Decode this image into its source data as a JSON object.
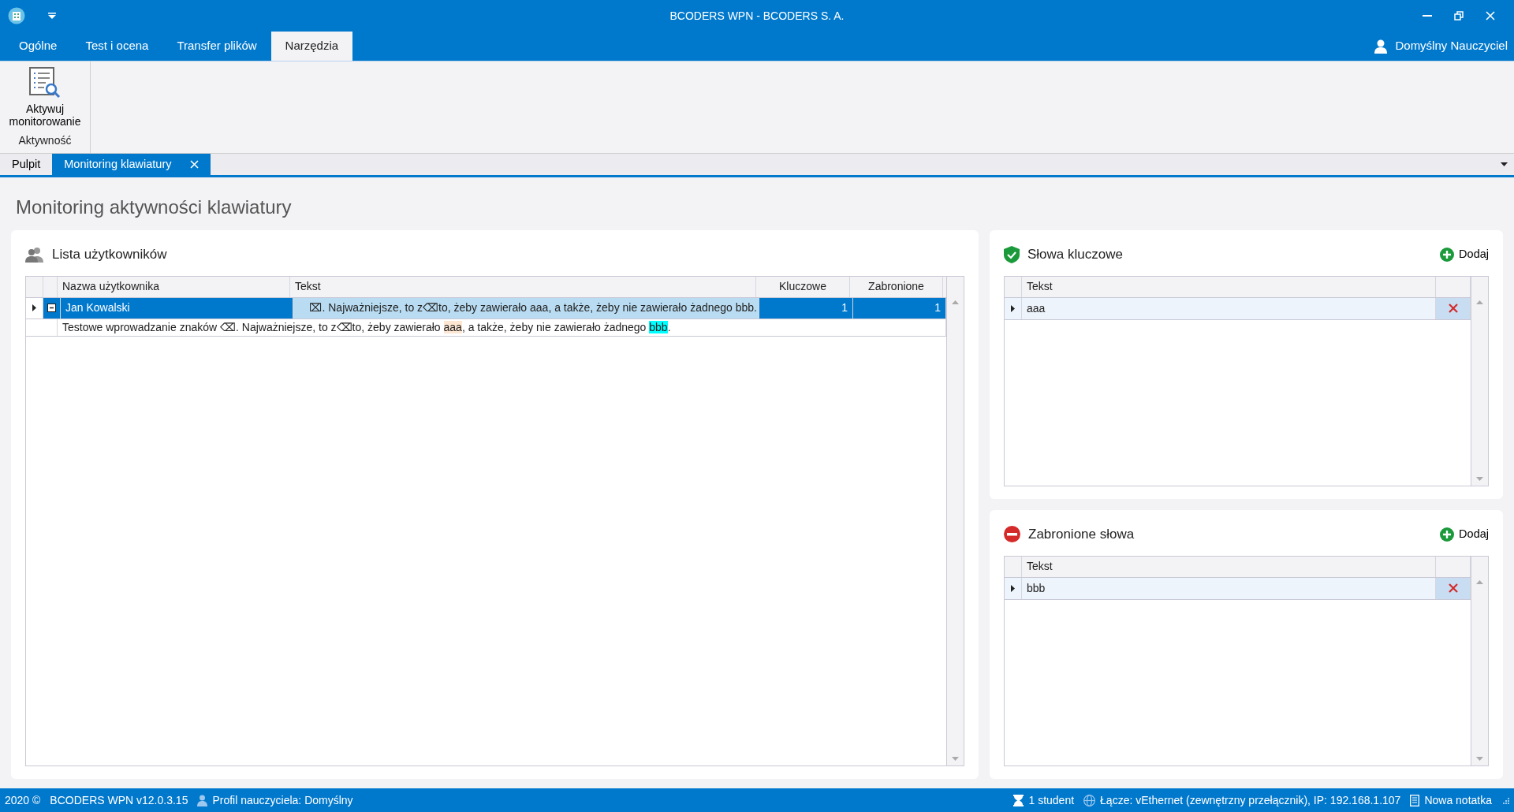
{
  "window": {
    "title": "BCODERS WPN - BCODERS S. A.",
    "user": "Domyślny Nauczyciel"
  },
  "ribbon_tabs": [
    {
      "label": "Ogólne",
      "selected": false
    },
    {
      "label": "Test i ocena",
      "selected": false
    },
    {
      "label": "Transfer plików",
      "selected": false
    },
    {
      "label": "Narzędzia",
      "selected": true
    }
  ],
  "ribbon_group": {
    "button": "Aktywuj monitorowanie",
    "caption": "Aktywność"
  },
  "doc_tabs": [
    {
      "label": "Pulpit",
      "selected": false,
      "closable": false
    },
    {
      "label": "Monitoring klawiatury",
      "selected": true,
      "closable": true
    }
  ],
  "page_title": "Monitoring aktywności klawiatury",
  "users_panel": {
    "title": "Lista użytkowników",
    "columns": [
      "Nazwa użytkownika",
      "Tekst",
      "Kluczowe",
      "Zabronione"
    ],
    "rows": [
      {
        "name": "Jan Kowalski",
        "text": "⌧. Najważniejsze, to z⌫to, żeby zawierało aaa, a także, żeby nie zawierało żadnego bbb.",
        "keywords": "1",
        "forbidden": "1",
        "selected": true,
        "expanded": true,
        "detail": [
          {
            "text": "Testowe wprowadzanie znaków ⌫. Najważniejsze, to z⌫to, żeby zawierało ",
            "kind": "plain"
          },
          {
            "text": "aaa",
            "kind": "keyword"
          },
          {
            "text": ", a także, żeby nie zawierało żadnego ",
            "kind": "plain"
          },
          {
            "text": "bbb",
            "kind": "forbidden"
          },
          {
            "text": ".",
            "kind": "plain"
          }
        ]
      }
    ]
  },
  "word_panels": [
    {
      "kind": "keyword",
      "title": "Słowa kluczowe",
      "add": "Dodaj",
      "column": "Tekst",
      "rows": [
        {
          "text": "aaa",
          "selected": true
        }
      ]
    },
    {
      "kind": "forbidden",
      "title": "Zabronione słowa",
      "add": "Dodaj",
      "column": "Tekst",
      "rows": [
        {
          "text": "bbb",
          "selected": true
        }
      ]
    }
  ],
  "status_bar": {
    "copyright": "2020 ©",
    "version": "BCODERS WPN v12.0.3.15",
    "profile": "Profil nauczyciela: Domyślny",
    "students": "1 student",
    "connection": "Łącze: vEthernet (zewnętrzny przełącznik), IP: 192.168.1.107",
    "note": "Nowa notatka"
  }
}
